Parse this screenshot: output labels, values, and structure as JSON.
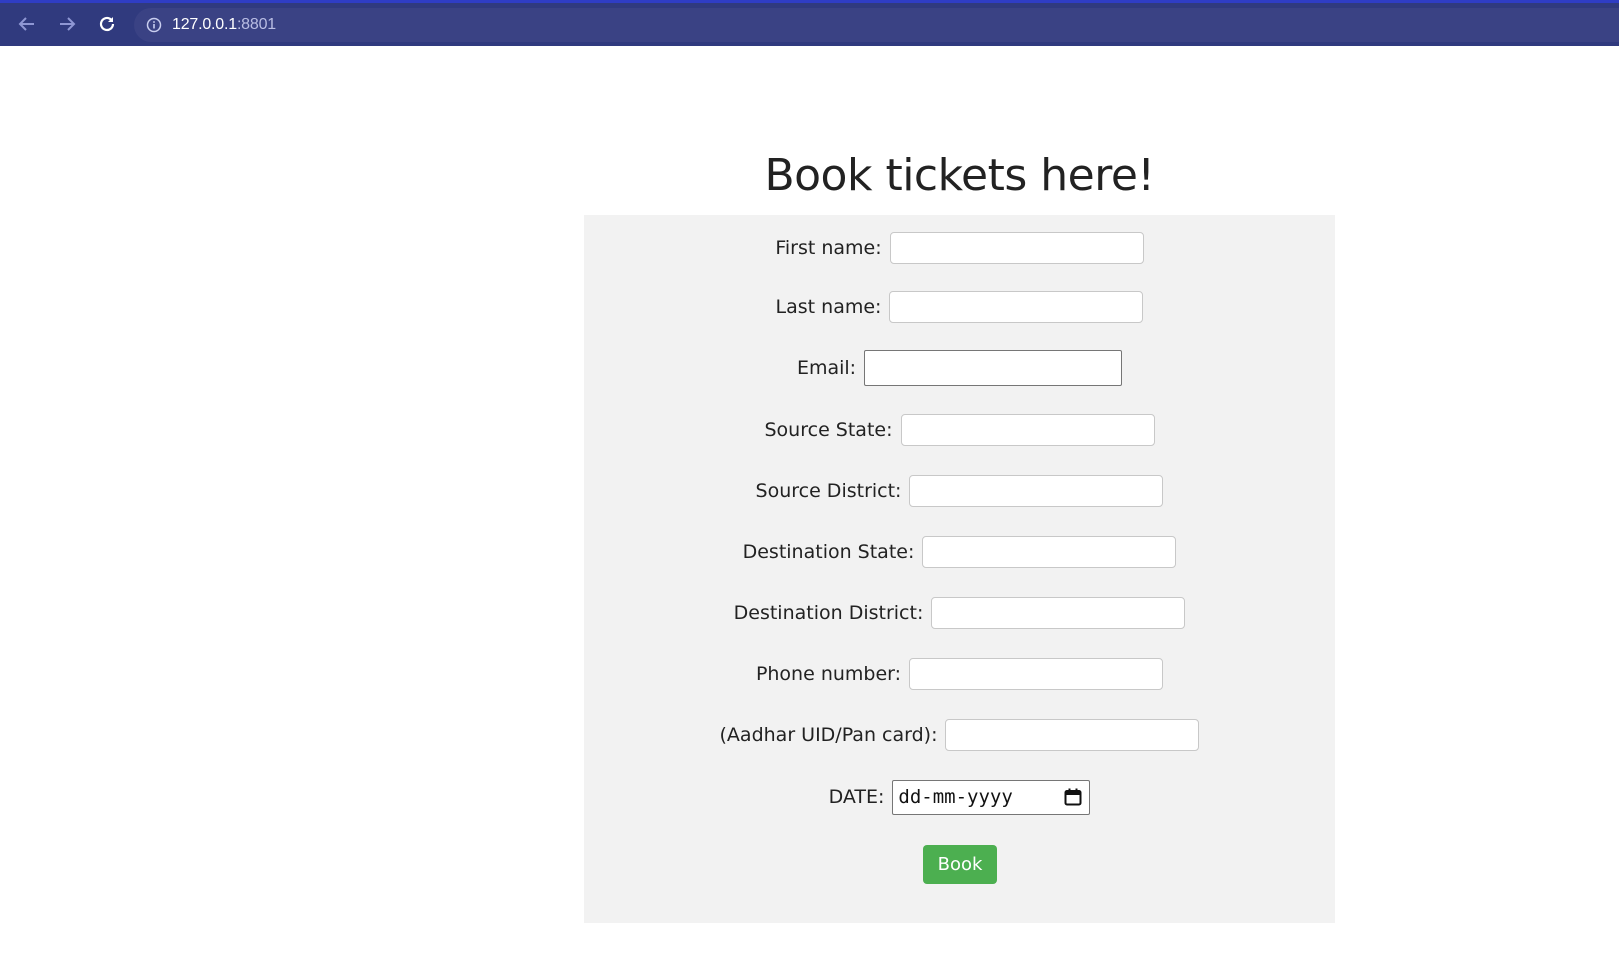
{
  "browser": {
    "url_host": "127.0.0.1",
    "url_port": ":8801",
    "colors": {
      "bar": "#303a7e",
      "omnibox": "#3a4284"
    }
  },
  "page": {
    "title": "Book tickets here!"
  },
  "form": {
    "fields": {
      "first_name": {
        "label": "First name:",
        "value": ""
      },
      "last_name": {
        "label": "Last name:",
        "value": ""
      },
      "email": {
        "label": "Email:",
        "value": ""
      },
      "source_state": {
        "label": "Source State:",
        "value": ""
      },
      "source_district": {
        "label": "Source District:",
        "value": ""
      },
      "destination_state": {
        "label": "Destination State:",
        "value": ""
      },
      "destination_district": {
        "label": "Destination District:",
        "value": ""
      },
      "phone_number": {
        "label": "Phone number:",
        "value": ""
      },
      "id_card": {
        "label": "(Aadhar UID/Pan card):",
        "value": ""
      },
      "date": {
        "label": "DATE:",
        "placeholder": "dd-mm-yyyy"
      }
    },
    "submit_label": "Book",
    "colors": {
      "panel": "#f2f2f2",
      "submit": "#4caf50"
    }
  }
}
